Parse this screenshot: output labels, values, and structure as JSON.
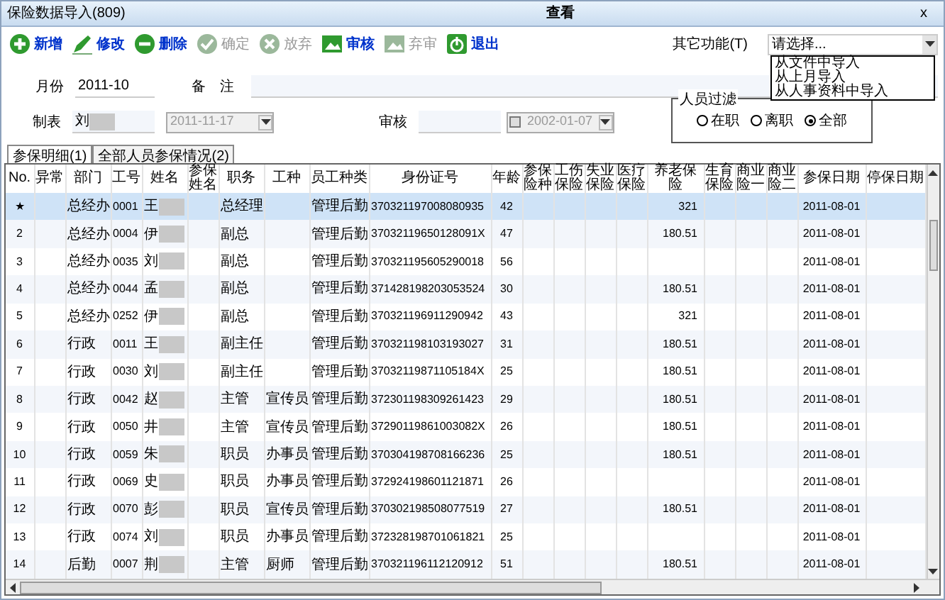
{
  "window": {
    "title": "保险数据导入(809)",
    "mode": "查看",
    "close": "x"
  },
  "toolbar": [
    {
      "label": "新增",
      "disabled": false
    },
    {
      "label": "修改",
      "disabled": false
    },
    {
      "label": "删除",
      "disabled": false
    },
    {
      "label": "确定",
      "disabled": true
    },
    {
      "label": "放弃",
      "disabled": true
    },
    {
      "label": "审核",
      "disabled": false
    },
    {
      "label": "弃审",
      "disabled": true
    },
    {
      "label": "退出",
      "disabled": false
    }
  ],
  "other": {
    "label": "其它功能(T)",
    "value": "请选择...",
    "options": [
      "从文件中导入",
      "从上月导入",
      "从人事资料中导入"
    ]
  },
  "form": {
    "month_label": "月份",
    "month": "2011-10",
    "note_label": "备　注",
    "maker_label": "制表",
    "maker": "刘",
    "maker_date": "2011-11-17",
    "audit_label": "审核",
    "audit_date": "2002-01-07",
    "audit_checked": false
  },
  "filter": {
    "title": "人员过滤",
    "options": [
      {
        "label": "在职",
        "selected": false
      },
      {
        "label": "离职",
        "selected": false
      },
      {
        "label": "全部",
        "selected": true
      }
    ]
  },
  "tabs": [
    {
      "label": "参保明细(1)",
      "selected": true
    },
    {
      "label": "全部人员参保情况(2)",
      "selected": false
    }
  ],
  "table": {
    "columns": [
      "No.",
      "异常",
      "部门",
      "工号",
      "姓名",
      "参保姓名",
      "职务",
      "工种",
      "员工种类",
      "身份证号",
      "年龄",
      "参保险种",
      "工伤保险",
      "失业保险",
      "医疗保险",
      "养老保险",
      "生育保险",
      "商业险一",
      "商业险二",
      "参保日期",
      "停保日期"
    ],
    "rows": [
      {
        "selected": true,
        "cells": [
          "★",
          "",
          "总经办",
          "0001",
          "王",
          "",
          "总经理",
          "",
          "管理后勤",
          "370321197008080935",
          "42",
          "",
          "",
          "",
          "",
          "321",
          "",
          "",
          "",
          "2011-08-01",
          ""
        ]
      },
      {
        "selected": false,
        "cells": [
          "2",
          "",
          "总经办",
          "0004",
          "伊",
          "",
          "副总",
          "",
          "管理后勤",
          "37032119650128091X",
          "47",
          "",
          "",
          "",
          "",
          "180.51",
          "",
          "",
          "",
          "2011-08-01",
          ""
        ]
      },
      {
        "selected": false,
        "cells": [
          "3",
          "",
          "总经办",
          "0035",
          "刘",
          "",
          "副总",
          "",
          "管理后勤",
          "370321195605290018",
          "56",
          "",
          "",
          "",
          "",
          "",
          "",
          "",
          "",
          "2011-08-01",
          ""
        ]
      },
      {
        "selected": false,
        "cells": [
          "4",
          "",
          "总经办",
          "0044",
          "孟",
          "",
          "副总",
          "",
          "管理后勤",
          "371428198203053524",
          "30",
          "",
          "",
          "",
          "",
          "180.51",
          "",
          "",
          "",
          "2011-08-01",
          ""
        ]
      },
      {
        "selected": false,
        "cells": [
          "5",
          "",
          "总经办",
          "0252",
          "伊",
          "",
          "副总",
          "",
          "管理后勤",
          "370321196911290942",
          "43",
          "",
          "",
          "",
          "",
          "321",
          "",
          "",
          "",
          "2011-08-01",
          ""
        ]
      },
      {
        "selected": false,
        "cells": [
          "6",
          "",
          "行政",
          "0011",
          "王",
          "",
          "副主任",
          "",
          "管理后勤",
          "370321198103193027",
          "31",
          "",
          "",
          "",
          "",
          "180.51",
          "",
          "",
          "",
          "2011-08-01",
          ""
        ]
      },
      {
        "selected": false,
        "cells": [
          "7",
          "",
          "行政",
          "0030",
          "刘",
          "",
          "副主任",
          "",
          "管理后勤",
          "37032119871105184X",
          "25",
          "",
          "",
          "",
          "",
          "180.51",
          "",
          "",
          "",
          "2011-08-01",
          ""
        ]
      },
      {
        "selected": false,
        "cells": [
          "8",
          "",
          "行政",
          "0042",
          "赵",
          "",
          "主管",
          "宣传员",
          "管理后勤",
          "372301198309261423",
          "29",
          "",
          "",
          "",
          "",
          "180.51",
          "",
          "",
          "",
          "2011-08-01",
          ""
        ]
      },
      {
        "selected": false,
        "cells": [
          "9",
          "",
          "行政",
          "0050",
          "井",
          "",
          "主管",
          "宣传员",
          "管理后勤",
          "37290119861003082X",
          "26",
          "",
          "",
          "",
          "",
          "180.51",
          "",
          "",
          "",
          "2011-08-01",
          ""
        ]
      },
      {
        "selected": false,
        "cells": [
          "10",
          "",
          "行政",
          "0059",
          "朱",
          "",
          "职员",
          "办事员",
          "管理后勤",
          "370304198708166236",
          "25",
          "",
          "",
          "",
          "",
          "180.51",
          "",
          "",
          "",
          "2011-08-01",
          ""
        ]
      },
      {
        "selected": false,
        "cells": [
          "11",
          "",
          "行政",
          "0069",
          "史",
          "",
          "职员",
          "办事员",
          "管理后勤",
          "372924198601121871",
          "26",
          "",
          "",
          "",
          "",
          "",
          "",
          "",
          "",
          "2011-08-01",
          ""
        ]
      },
      {
        "selected": false,
        "cells": [
          "12",
          "",
          "行政",
          "0070",
          "彭",
          "",
          "职员",
          "宣传员",
          "管理后勤",
          "370302198508077519",
          "27",
          "",
          "",
          "",
          "",
          "180.51",
          "",
          "",
          "",
          "2011-08-01",
          ""
        ]
      },
      {
        "selected": false,
        "cells": [
          "13",
          "",
          "行政",
          "0074",
          "刘",
          "",
          "职员",
          "办事员",
          "管理后勤",
          "372328198701061821",
          "25",
          "",
          "",
          "",
          "",
          "",
          "",
          "",
          "",
          "2011-08-01",
          ""
        ]
      },
      {
        "selected": false,
        "cells": [
          "14",
          "",
          "后勤",
          "0007",
          "荆",
          "",
          "主管",
          "厨师",
          "管理后勤",
          "370321196112120912",
          "51",
          "",
          "",
          "",
          "",
          "180.51",
          "",
          "",
          "",
          "2011-08-01",
          ""
        ]
      }
    ]
  }
}
